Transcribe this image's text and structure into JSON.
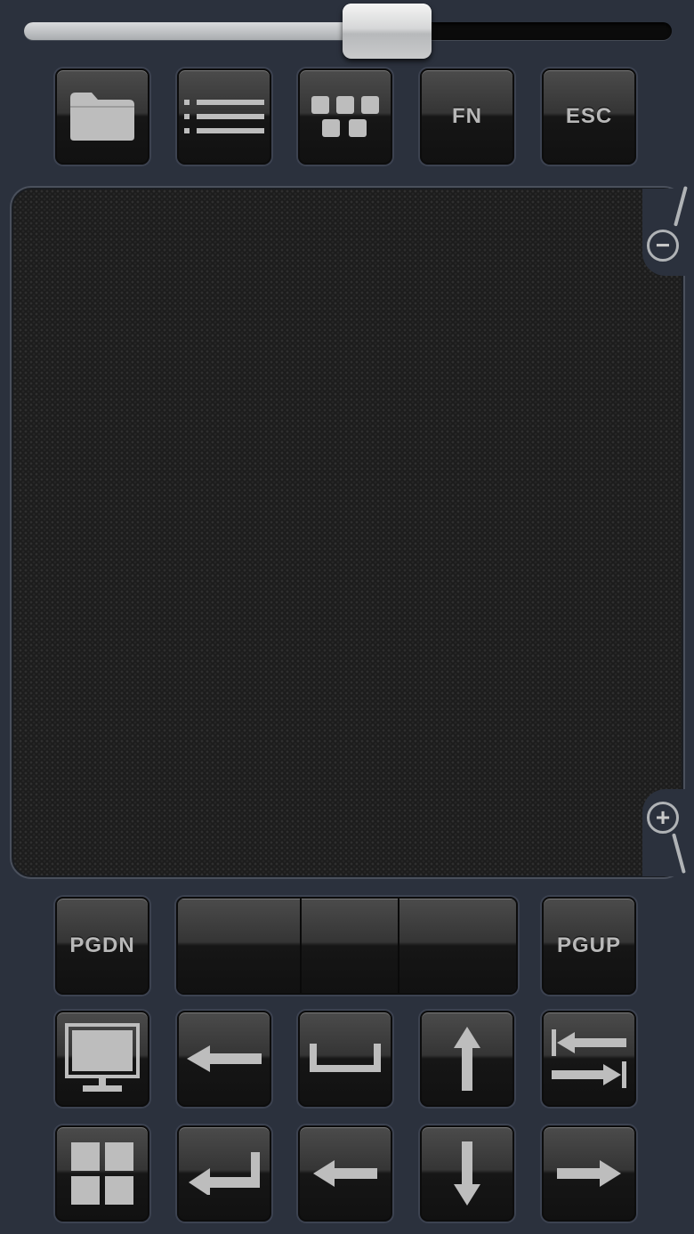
{
  "slider": {
    "value": 0.56
  },
  "toolbar": {
    "folder_icon": "folder-icon",
    "list_icon": "list-icon",
    "keyboard_icon": "keyboard-icon",
    "fn_label": "FN",
    "esc_label": "ESC"
  },
  "touchpad": {
    "zoom_out_symbol": "−",
    "zoom_in_symbol": "+"
  },
  "nav": {
    "pgdn_label": "PGDN",
    "pgup_label": "PGUP"
  },
  "colors": {
    "background": "#2b313d",
    "button_text": "#b8b8b8",
    "slider_fill": "#c4c6c8"
  }
}
